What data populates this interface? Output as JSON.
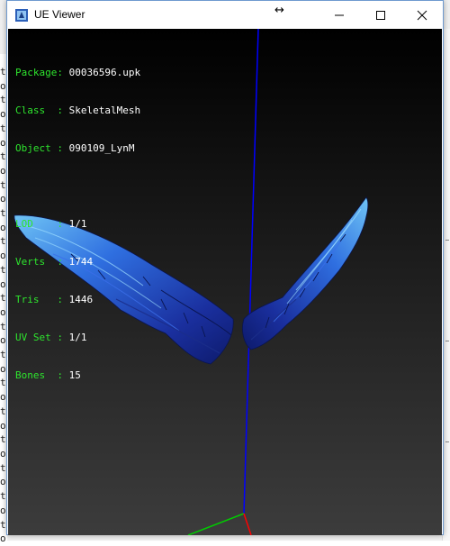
{
  "window": {
    "title": "UE Viewer"
  },
  "background": {
    "gutter_chars": "t\no\nt\no\nt\no\nt\no\nt\no\nt\no\nt\no\nt\no\nt\no\nt\no\nt\no\nt\no\nt\no\nt\no\nt\no\nt\no\nt\no"
  },
  "mesh_info": {
    "package": {
      "key": "Package:",
      "value": "00036596.upk"
    },
    "class": {
      "key": "Class  :",
      "value": "SkeletalMesh"
    },
    "object": {
      "key": "Object :",
      "value": "090109_LynM"
    },
    "lod": {
      "key": "LOD    :",
      "value": "1/1"
    },
    "verts": {
      "key": "Verts  :",
      "value": "1744"
    },
    "tris": {
      "key": "Tris   :",
      "value": "1446"
    },
    "uvset": {
      "key": "UV Set :",
      "value": "1/1"
    },
    "bones": {
      "key": "Bones  :",
      "value": "15"
    }
  },
  "colors": {
    "info_key": "#2ee52e",
    "info_value": "#ffffff",
    "axis_z": "#0000ff",
    "axis_x": "#ff0000",
    "axis_y": "#00cc00",
    "wing_dark": "#0d1a6b",
    "wing_mid": "#2a4bd1",
    "wing_light": "#6fc4f5"
  },
  "icons": {
    "app": "ue-viewer-app-icon",
    "resize": "horizontal-resize-cursor-icon",
    "minimize": "minimize-icon",
    "maximize": "maximize-icon",
    "close": "close-icon"
  }
}
